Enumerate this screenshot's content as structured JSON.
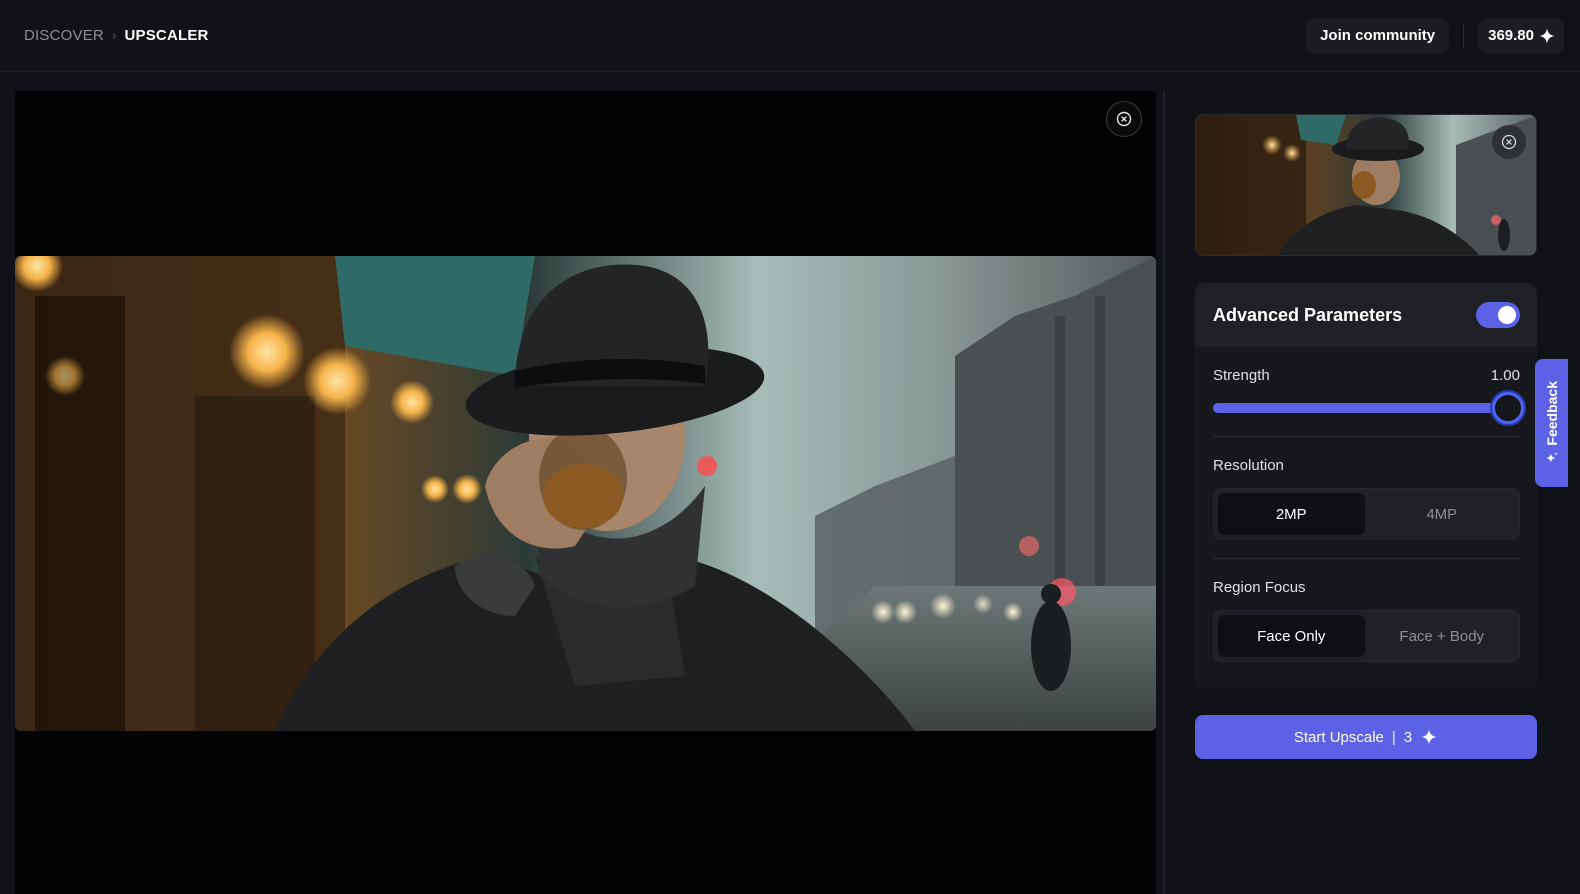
{
  "breadcrumb": {
    "root": "DISCOVER",
    "separator": "›",
    "current": "UPSCALER"
  },
  "header": {
    "join_label": "Join community",
    "credits": "369.80"
  },
  "params": {
    "title": "Advanced Parameters",
    "toggle_on": true,
    "strength_label": "Strength",
    "strength_value": "1.00",
    "strength_level": 1.0,
    "resolution_label": "Resolution",
    "resolution_options": [
      "2MP",
      "4MP"
    ],
    "resolution_selected": "2MP",
    "region_label": "Region Focus",
    "region_options": [
      "Face Only",
      "Face + Body"
    ],
    "region_selected": "Face Only"
  },
  "start": {
    "label": "Start Upscale",
    "separator": "|",
    "cost": "3"
  },
  "feedback": {
    "label": "Feedback"
  },
  "colors": {
    "accent": "#5b62e6",
    "background": "#111217",
    "panel": "#17181d"
  },
  "icons": {
    "close": "close-circle-icon",
    "sparkle": "sparkle-icon",
    "chevron": "chevron-right-icon"
  }
}
